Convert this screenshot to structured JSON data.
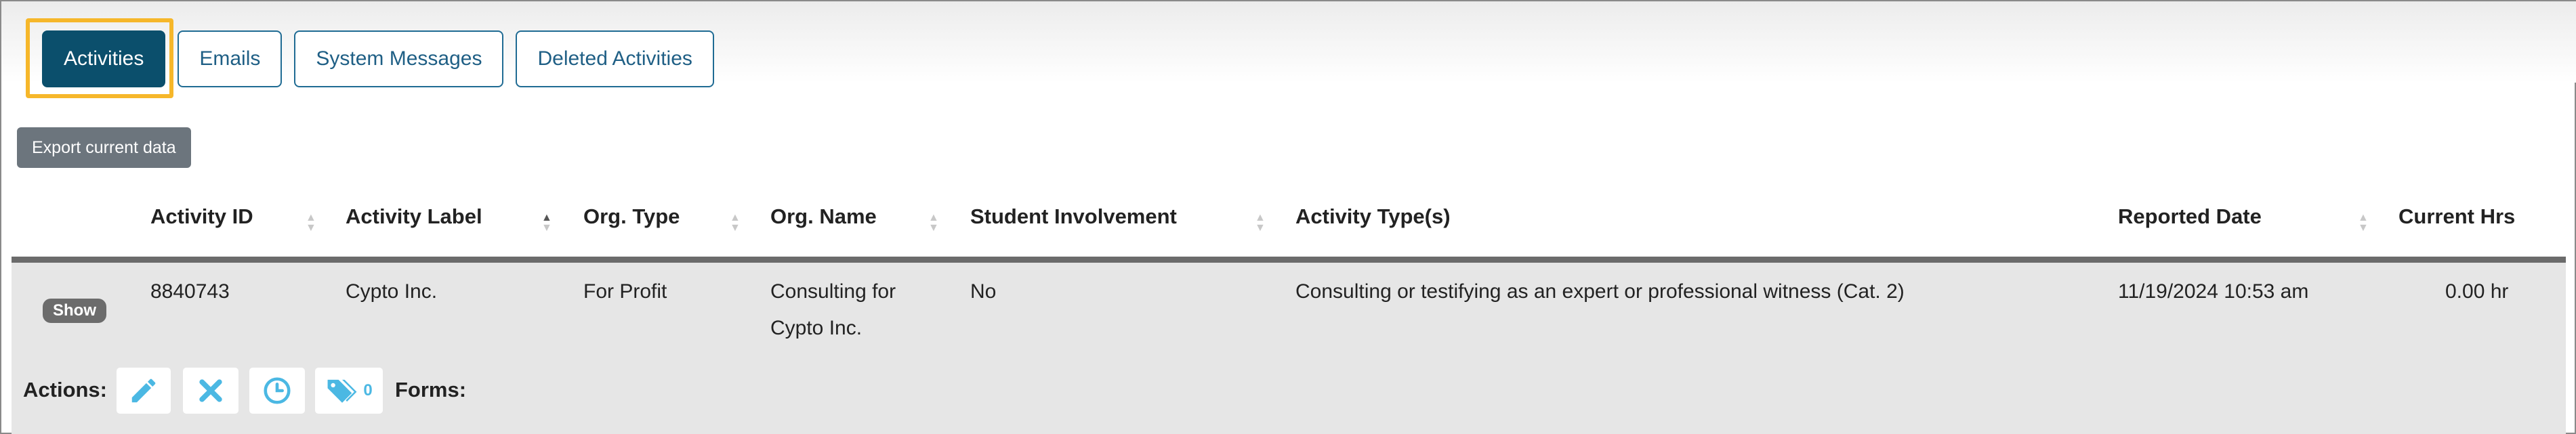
{
  "tabs": [
    {
      "label": "Activities",
      "active": true
    },
    {
      "label": "Emails",
      "active": false
    },
    {
      "label": "System Messages",
      "active": false
    },
    {
      "label": "Deleted Activities",
      "active": false
    }
  ],
  "toolbar": {
    "export_label": "Export current data"
  },
  "table": {
    "columns": [
      "Activity ID",
      "Activity Label",
      "Org. Type",
      "Org. Name",
      "Student Involvement",
      "Activity Type(s)",
      "Reported Date",
      "Current Hrs"
    ],
    "sorted_column": "Activity Label",
    "rows": [
      {
        "show_label": "Show",
        "activity_id": "8840743",
        "activity_label": "Cypto Inc.",
        "org_type": "For Profit",
        "org_name_line1": "Consulting for",
        "org_name_line2": "Cypto Inc.",
        "student_involvement": "No",
        "activity_types": "Consulting or testifying as an expert or professional witness (Cat. 2)",
        "reported_date": "11/19/2024 10:53 am",
        "current_hrs": "0.00 hr",
        "actions_label": "Actions:",
        "tag_count": "0",
        "forms_label": "Forms:"
      }
    ]
  },
  "colors": {
    "accent": "#0b4f6c",
    "focus": "#f6b72a",
    "icon": "#4bb8e3"
  },
  "icons": [
    "pencil-icon",
    "close-icon",
    "clock-icon",
    "tag-icon",
    "sort-icon"
  ]
}
